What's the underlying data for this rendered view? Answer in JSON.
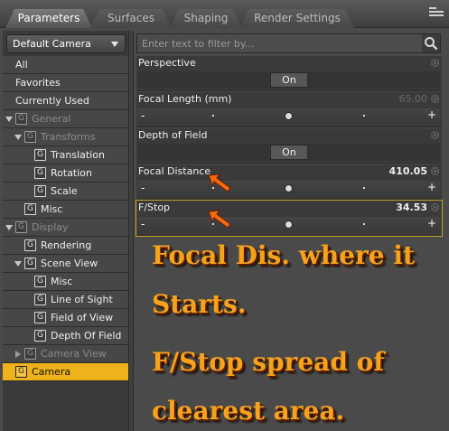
{
  "tabs": [
    {
      "label": "Parameters",
      "active": true
    },
    {
      "label": "Surfaces",
      "active": false
    },
    {
      "label": "Shaping",
      "active": false
    },
    {
      "label": "Render Settings",
      "active": false
    }
  ],
  "tab_menu_icon": "panel-menu-icon",
  "camera_select": {
    "value": "Default Camera"
  },
  "tree": {
    "all": "All",
    "favorites": "Favorites",
    "currently_used": "Currently Used",
    "general": "General",
    "transforms": "Transforms",
    "translation": "Translation",
    "rotation": "Rotation",
    "scale": "Scale",
    "misc": "Misc",
    "display": "Display",
    "rendering": "Rendering",
    "scene_view": "Scene View",
    "sv_misc": "Misc",
    "line_of_sight": "Line of Sight",
    "field_of_view": "Field of View",
    "depth_of_field": "Depth Of Field",
    "camera_view": "Camera View",
    "camera": "Camera",
    "group_icon_glyph": "G"
  },
  "filter": {
    "placeholder": "Enter text to filter by..."
  },
  "params": {
    "perspective": {
      "label": "Perspective",
      "button": "On"
    },
    "focal_length": {
      "label": "Focal Length (mm)",
      "value": "65.00",
      "slider_fraction": 0.5
    },
    "depth_of_field": {
      "label": "Depth of Field",
      "button": "On"
    },
    "focal_distance": {
      "label": "Focal Distance",
      "value": "410.05",
      "slider_fraction": 0.5
    },
    "fstop": {
      "label": "F/Stop",
      "value": "34.53",
      "slider_fraction": 0.5
    },
    "minus": "-",
    "plus": "+"
  },
  "annotations": {
    "line1": "Focal Dis. where it",
    "line2": "Starts.",
    "line3": "F/Stop spread of",
    "line4": "clearest area."
  },
  "colors": {
    "selected_row": "#f0b21b",
    "annotation_text": "#f6a21a",
    "pointer": "#f06a10"
  }
}
